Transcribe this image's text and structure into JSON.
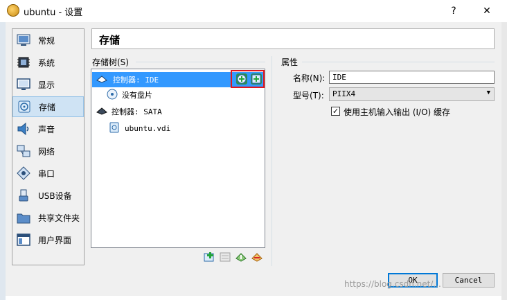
{
  "window": {
    "title": "ubuntu - 设置",
    "help_btn": "?",
    "close_btn": "✕"
  },
  "sidebar": {
    "items": [
      {
        "label": "常规",
        "icon": "general-icon"
      },
      {
        "label": "系统",
        "icon": "system-icon"
      },
      {
        "label": "显示",
        "icon": "display-icon"
      },
      {
        "label": "存储",
        "icon": "storage-icon",
        "selected": true
      },
      {
        "label": "声音",
        "icon": "audio-icon"
      },
      {
        "label": "网络",
        "icon": "network-icon"
      },
      {
        "label": "串口",
        "icon": "serial-port-icon"
      },
      {
        "label": "USB设备",
        "icon": "usb-icon"
      },
      {
        "label": "共享文件夹",
        "icon": "shared-folder-icon"
      },
      {
        "label": "用户界面",
        "icon": "user-interface-icon"
      }
    ]
  },
  "header": {
    "title": "存储"
  },
  "storage": {
    "tree_label": "存储树(S)",
    "tree": [
      {
        "label": "控制器: IDE",
        "type": "controller-ide",
        "selected": true
      },
      {
        "label": "没有盘片",
        "type": "optical-disk"
      },
      {
        "label": "控制器: SATA",
        "type": "controller-sata"
      },
      {
        "label": "ubuntu.vdi",
        "type": "hard-disk"
      }
    ]
  },
  "attributes": {
    "group_label": "属性",
    "name_label": "名称(N):",
    "name_value": "IDE",
    "type_label": "型号(T):",
    "type_value": "PIIX4",
    "use_host_io_label": "使用主机输入输出 (I/O) 缓存",
    "use_host_io_checked": true
  },
  "buttons": {
    "ok": "OK",
    "cancel": "Cancel"
  },
  "watermark": "https://blog.csdn.net/..."
}
